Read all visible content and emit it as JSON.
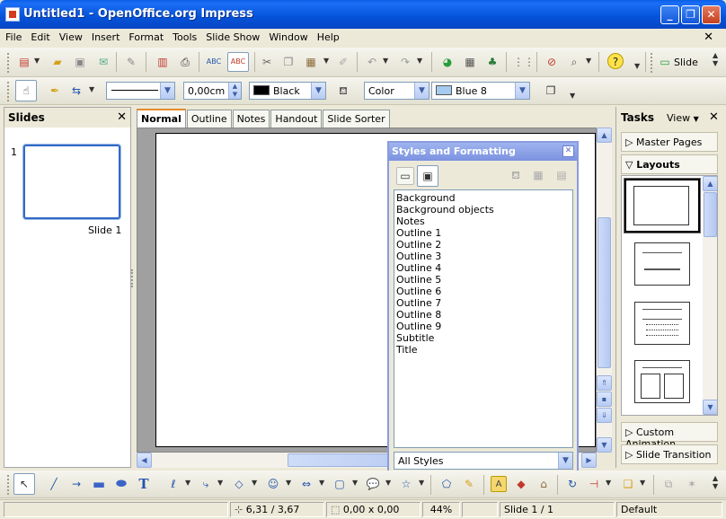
{
  "window": {
    "title": "Untitled1 - OpenOffice.org Impress"
  },
  "menu": [
    "File",
    "Edit",
    "View",
    "Insert",
    "Format",
    "Tools",
    "Slide Show",
    "Window",
    "Help"
  ],
  "toolbar_std": {
    "slide_button": "Slide"
  },
  "toolbar_line": {
    "line_width": "0,00cm",
    "line_color": "Black",
    "area_style": "Color",
    "area_color": "Blue 8",
    "line_color_hex": "#000000",
    "area_color_hex": "#a6caf0"
  },
  "slides_pane": {
    "title": "Slides",
    "slide_number": "1",
    "slide_label": "Slide 1"
  },
  "view_tabs": [
    "Normal",
    "Outline",
    "Notes",
    "Handout",
    "Slide Sorter"
  ],
  "styles_window": {
    "title": "Styles and Formatting",
    "styles": [
      "Background",
      "Background objects",
      "Notes",
      "Outline 1",
      "Outline 2",
      "Outline 3",
      "Outline 4",
      "Outline 5",
      "Outline 6",
      "Outline 7",
      "Outline 8",
      "Outline 9",
      "Subtitle",
      "Title"
    ],
    "filter": "All Styles"
  },
  "tasks_pane": {
    "title": "Tasks",
    "view_label": "View",
    "sections": {
      "master_pages": "Master Pages",
      "layouts": "Layouts",
      "custom_animation": "Custom Animation",
      "slide_transition": "Slide Transition"
    }
  },
  "status": {
    "position": "6,31 / 3,67",
    "size": "0,00 x 0,00",
    "zoom": "44%",
    "slide": "Slide 1 / 1",
    "layout": "Default"
  }
}
